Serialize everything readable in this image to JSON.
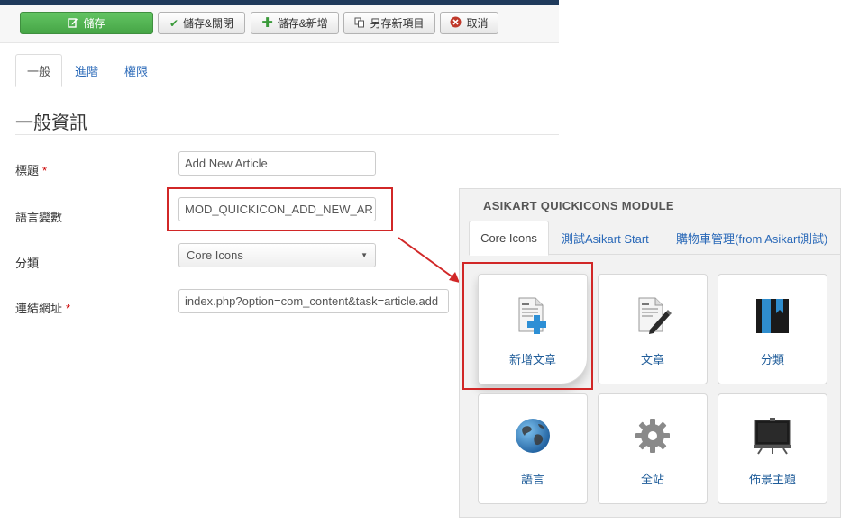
{
  "toolbar": {
    "save_label": "儲存",
    "save_close_label": "儲存&關閉",
    "save_new_label": "儲存&新增",
    "save_copy_label": "另存新項目",
    "cancel_label": "取消"
  },
  "tabs": [
    {
      "label": "一般",
      "active": true
    },
    {
      "label": "進階",
      "active": false
    },
    {
      "label": "權限",
      "active": false
    }
  ],
  "form": {
    "section_title": "一般資訊",
    "fields": {
      "title": {
        "label": "標題",
        "required": "*",
        "value": "Add New Article"
      },
      "lang_var": {
        "label": "語言變數",
        "value": "MOD_QUICKICON_ADD_NEW_AR"
      },
      "category": {
        "label": "分類",
        "value": "Core Icons"
      },
      "link": {
        "label": "連結網址",
        "required": "*",
        "value": "index.php?option=com_content&task=article.add"
      }
    }
  },
  "quickicons": {
    "title": "ASIKART QUICKICONS MODULE",
    "tabs": [
      {
        "label": "Core Icons",
        "active": true
      },
      {
        "label": "測試Asikart Start",
        "active": false
      },
      {
        "label": "購物車管理(from Asikart測試)",
        "active": false
      }
    ],
    "buttons": [
      {
        "label": "新增文章",
        "icon": "add-article-icon"
      },
      {
        "label": "文章",
        "icon": "article-icon"
      },
      {
        "label": "分類",
        "icon": "category-icon"
      },
      {
        "label": "語言",
        "icon": "globe-icon"
      },
      {
        "label": "全站",
        "icon": "gear-icon"
      },
      {
        "label": "佈景主題",
        "icon": "template-icon"
      }
    ]
  },
  "colors": {
    "highlight": "#d12727",
    "save_green": "#46a546",
    "link_blue": "#2a69b8"
  }
}
